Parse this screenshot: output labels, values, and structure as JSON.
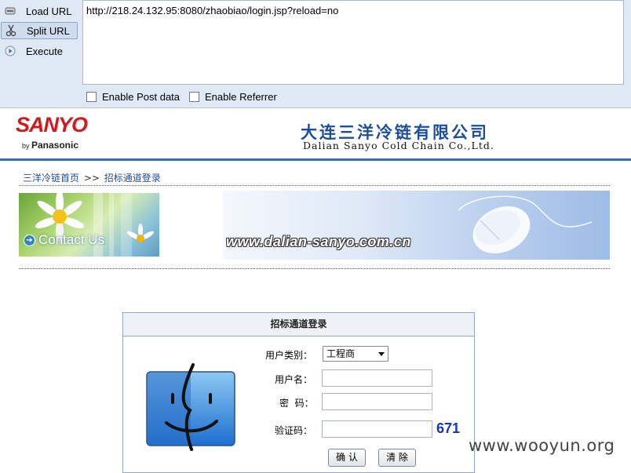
{
  "hackbar": {
    "load_url": "Load URL",
    "split_url": "Split URL",
    "execute": "Execute",
    "url": "http://218.24.132.95:8080/zhaobiao/login.jsp?reload=no",
    "enable_post": "Enable Post data",
    "enable_referrer": "Enable Referrer"
  },
  "header": {
    "logo_brand": "SANYO",
    "logo_by": "by",
    "logo_parent": "Panasonic",
    "company_cn": "大连三洋冷链有限公司",
    "company_en": "Dalian Sanyo Cold Chain Co.,Ltd."
  },
  "breadcrumb": {
    "home": "三洋冷链首页",
    "sep": ">>",
    "current": "招标通道登录"
  },
  "banner": {
    "contact": "Contact Us",
    "website": "www.dalian-sanyo.com.cn"
  },
  "login": {
    "title": "招标通道登录",
    "type_label": "用户类别：",
    "type_value": "工程商",
    "user_label": "用户名：",
    "pass_label": "密  码：",
    "code_label": "验证码：",
    "captcha": "671",
    "confirm": "确 认",
    "clear": "清 除"
  },
  "watermark": "www.wooyun.org",
  "colors": {
    "toolbar_bg": "#dfe9f5",
    "sanyo_red": "#d6171c",
    "company_blue": "#1c4f96",
    "captcha_blue": "#1a35b5"
  }
}
